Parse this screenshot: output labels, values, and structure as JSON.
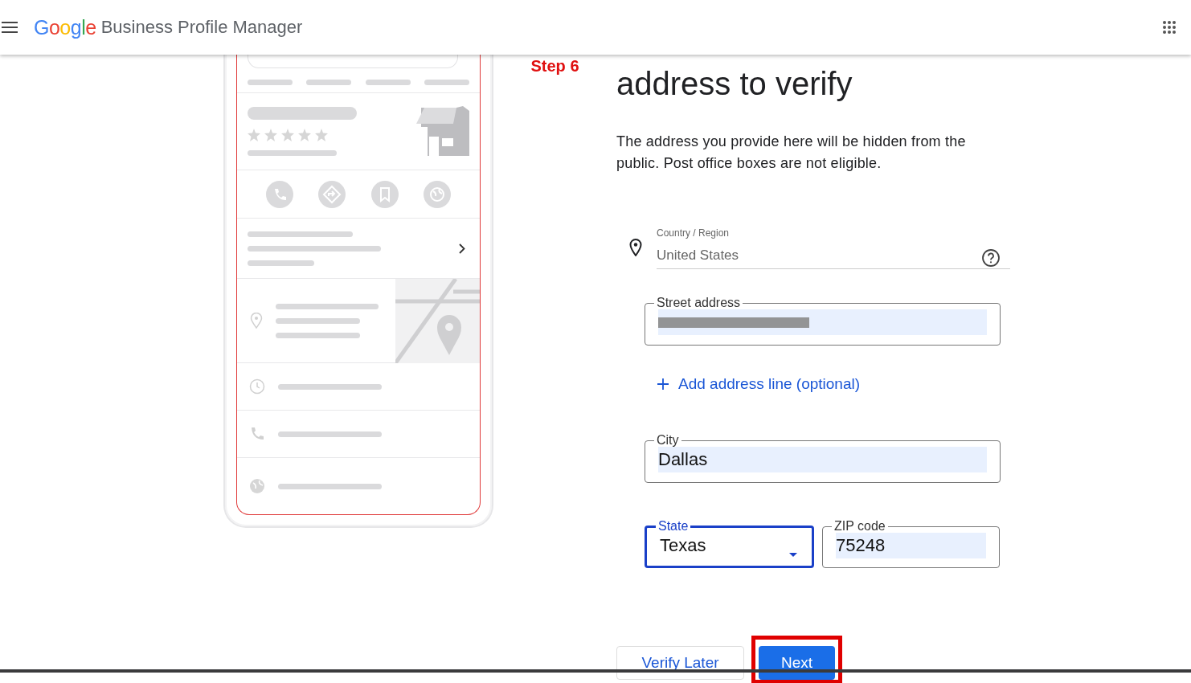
{
  "header": {
    "brand": "Google",
    "product": "Business Profile Manager"
  },
  "annotation": {
    "text": "Step 6"
  },
  "heading": "address to verify",
  "description": "The address you provide here will be hidden from the public. Post office boxes are not eligible.",
  "country": {
    "label": "Country / Region",
    "value": "United States"
  },
  "street": {
    "label": "Street address",
    "redacted": true,
    "autofilled": true,
    "focused": false
  },
  "add_line": {
    "label": "Add address line (optional)"
  },
  "city": {
    "label": "City",
    "value": "Dallas",
    "autofilled": true,
    "focused": false
  },
  "state": {
    "label": "State",
    "value": "Texas",
    "autofilled": false,
    "focused": true
  },
  "zip": {
    "label": "ZIP code",
    "value": "75248",
    "autofilled": true,
    "focused": false
  },
  "buttons": [
    {
      "label": "Verify Later",
      "kind": "secondary",
      "highlighted": false
    },
    {
      "label": "Next",
      "kind": "primary",
      "highlighted": true
    }
  ]
}
